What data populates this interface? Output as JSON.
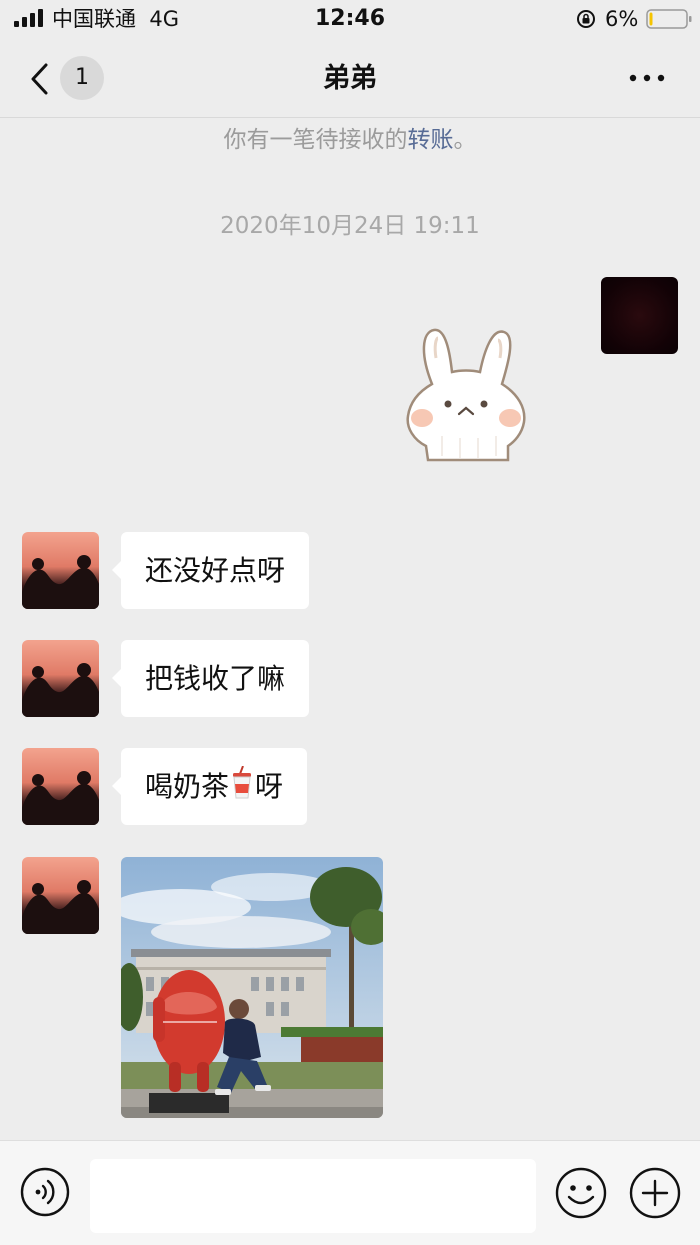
{
  "status_bar": {
    "carrier": "中国联通",
    "network": "4G",
    "time": "12:46",
    "battery_percent": "6%",
    "battery_level": 0.06
  },
  "nav": {
    "unread_count": "1",
    "title": "弟弟"
  },
  "chat": {
    "system_notice_prefix": "你有一笔待接收的",
    "system_notice_link": "转账",
    "system_notice_suffix": "。",
    "timestamp": "2020年10月24日 19:11",
    "messages": [
      {
        "text": "还没好点呀"
      },
      {
        "text": "把钱收了嘛"
      },
      {
        "text_before": "喝奶茶",
        "icon": "milk-tea-icon",
        "text_after": "呀"
      }
    ]
  },
  "input": {
    "placeholder": ""
  },
  "colors": {
    "background": "#ededed",
    "bubble": "#ffffff",
    "link": "#576b95",
    "system_text": "#9b9b9b"
  }
}
